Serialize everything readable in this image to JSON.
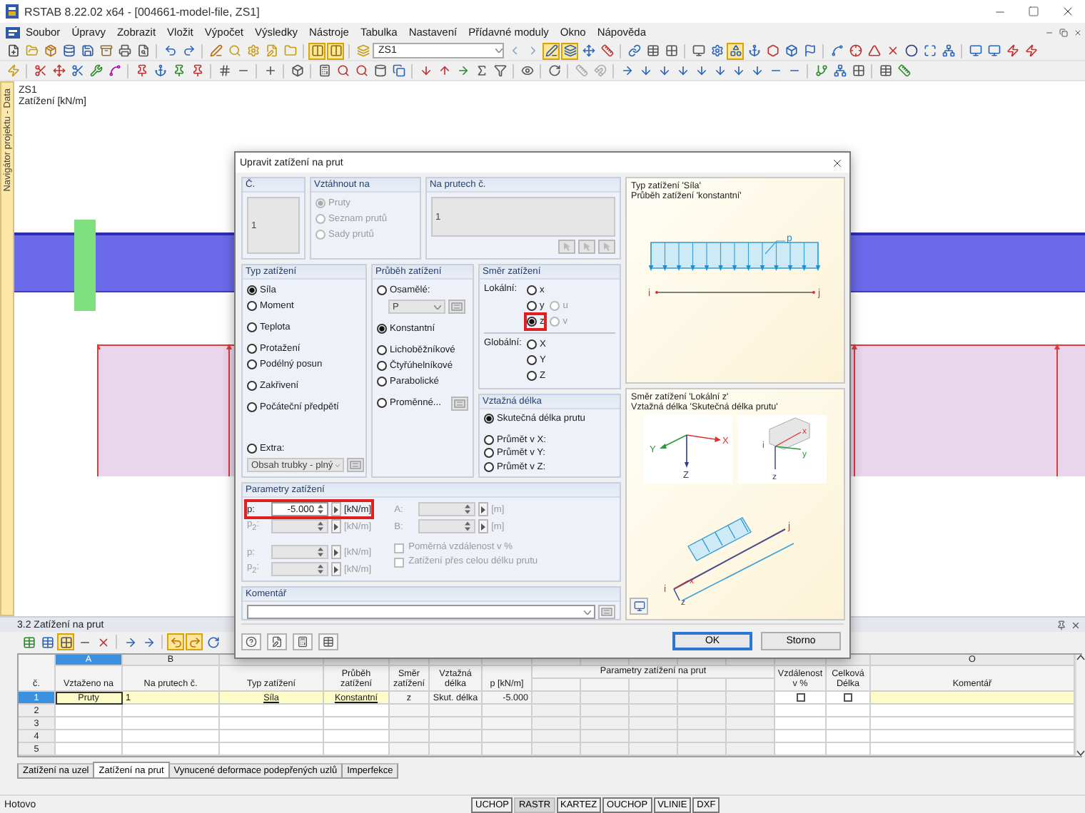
{
  "window": {
    "title": "RSTAB 8.22.02 x64 - [004661-model-file, ZS1]"
  },
  "menu": [
    "Soubor",
    "Úpravy",
    "Zobrazit",
    "Vložit",
    "Výpočet",
    "Výsledky",
    "Nástroje",
    "Tabulka",
    "Nastavení",
    "Přídavné moduly",
    "Okno",
    "Nápověda"
  ],
  "toolbar": {
    "load_case": "ZS1"
  },
  "navigator_tab": "Navigátor projektu - Data",
  "workspace": {
    "title": "ZS1",
    "subtitle": "Zatížení [kN/m]"
  },
  "dialog": {
    "title": "Upravit zatížení na prut",
    "number": {
      "label": "Č.",
      "value": "1"
    },
    "relate_to": {
      "label": "Vztáhnout na",
      "options": [
        {
          "label": "Pruty",
          "selected": true,
          "disabled": true
        },
        {
          "label": "Seznam prutů",
          "selected": false,
          "disabled": true
        },
        {
          "label": "Sady prutů",
          "selected": false,
          "disabled": true
        }
      ]
    },
    "members": {
      "label": "Na prutech č.",
      "value": "1"
    },
    "load_type": {
      "label": "Typ zatížení",
      "groups": [
        [
          {
            "label": "Síla",
            "selected": true
          },
          {
            "label": "Moment",
            "selected": false
          }
        ],
        [
          {
            "label": "Teplota",
            "selected": false
          }
        ],
        [
          {
            "label": "Protažení",
            "selected": false
          },
          {
            "label": "Podélný posun",
            "selected": false
          }
        ],
        [
          {
            "label": "Zakřivení",
            "selected": false
          }
        ],
        [
          {
            "label": "Počáteční předpětí",
            "selected": false
          }
        ]
      ],
      "extra": {
        "label": "Extra:",
        "selected": false,
        "value": "Obsah trubky - plný"
      }
    },
    "distribution": {
      "label": "Průběh zatížení",
      "concentrated": {
        "label": "Osamělé:",
        "selected": false,
        "value": "P"
      },
      "groups": [
        [
          {
            "label": "Konstantní",
            "selected": true
          }
        ],
        [
          {
            "label": "Lichoběžníkové",
            "selected": false
          },
          {
            "label": "Čtyřúhelníkové",
            "selected": false
          },
          {
            "label": "Parabolické",
            "selected": false
          }
        ]
      ],
      "varying": {
        "label": "Proměnné...",
        "selected": false
      }
    },
    "direction": {
      "label": "Směr zatížení",
      "local_label": "Lokální:",
      "local": [
        {
          "label": "x",
          "selected": false,
          "highlighted": false
        },
        {
          "label": "y",
          "selected": false,
          "highlighted": false
        },
        {
          "label": "z",
          "selected": true,
          "highlighted": true
        }
      ],
      "local_extra": [
        {
          "label": "u",
          "selected": false,
          "disabled": true
        },
        {
          "label": "v",
          "selected": false,
          "disabled": true
        }
      ],
      "global_label": "Globální:",
      "global": [
        {
          "label": "X",
          "selected": false
        },
        {
          "label": "Y",
          "selected": false
        },
        {
          "label": "Z",
          "selected": false
        }
      ]
    },
    "reference_length": {
      "label": "Vztažná délka",
      "options": [
        {
          "label": "Skutečná délka prutu",
          "selected": true
        },
        {
          "label": "Průmět v X:",
          "selected": false
        },
        {
          "label": "Průmět v Y:",
          "selected": false
        },
        {
          "label": "Průmět v Z:",
          "selected": false
        }
      ]
    },
    "parameters": {
      "label": "Parametry zatížení",
      "fields": [
        {
          "label": "p:",
          "value": "-5.000",
          "unit": "[kN/m]",
          "disabled": false,
          "highlighted": true
        },
        {
          "label": "p$_{2}$:",
          "unit": "[kN/m]",
          "disabled": true,
          "highlighted": false
        },
        {
          "label": "p:",
          "unit": "[kN/m]",
          "disabled": true,
          "highlighted": false
        },
        {
          "label": "p$_{2}$:",
          "unit": "[kN/m]",
          "disabled": true,
          "highlighted": false
        }
      ],
      "right_fields": [
        {
          "label": "A:",
          "unit": "[m]",
          "disabled": true
        },
        {
          "label": "B:",
          "unit": "[m]",
          "disabled": true
        }
      ],
      "checks": [
        {
          "label": "Poměrná vzdálenost v %",
          "checked": false,
          "disabled": true
        },
        {
          "label": "Zatížení přes celou délku prutu",
          "checked": false,
          "disabled": true
        }
      ]
    },
    "comment": {
      "label": "Komentář"
    },
    "preview_type": {
      "lines": [
        "Typ zatížení 'Síla'",
        "Průběh zatížení 'konstantní'"
      ],
      "labels": [
        "p",
        "i",
        "j"
      ]
    },
    "preview_direction": {
      "lines": [
        "Směr zatížení 'Lokální z'",
        "Vztažná délka 'Skutečná délka prutu'"
      ],
      "global_axes": [
        "X",
        "Y",
        "Z"
      ],
      "local_axes": [
        "x",
        "i",
        "y",
        "z"
      ],
      "member_labels": [
        "j",
        "i",
        "x",
        "z"
      ]
    },
    "buttons": [
      "OK",
      "Storno"
    ]
  },
  "panel": {
    "title": "3.2 Zatížení na prut"
  },
  "table": {
    "row_header": "č.",
    "group_header": "Parametry zatížení na prut",
    "columns": [
      {
        "letter": "A",
        "header": "Vztaženo na",
        "kind": "text",
        "selected": true
      },
      {
        "letter": "B",
        "header": "Na prutech č.",
        "kind": "text",
        "selected": false
      },
      {
        "header": "Typ zatížení",
        "kind": "list",
        "selected": false
      },
      {
        "header": "Průběh\nzatížení",
        "kind": "list",
        "selected": false
      },
      {
        "header": "Směr\nzatížení",
        "kind": "text",
        "selected": false
      },
      {
        "header": "Vztažná\ndélka",
        "kind": "text",
        "selected": false
      },
      {
        "header": "p [kN/m]",
        "kind": "number",
        "selected": false
      },
      {
        "kind": "param",
        "selected": false
      },
      {
        "kind": "param",
        "selected": false
      },
      {
        "kind": "param",
        "selected": false
      },
      {
        "kind": "param",
        "selected": false
      },
      {
        "kind": "param",
        "selected": false
      },
      {
        "header": "Vzdálenost\nv %",
        "kind": "check",
        "selected": false
      },
      {
        "header": "Celková\nDélka",
        "kind": "check",
        "selected": false
      },
      {
        "letter": "O",
        "header": "Komentář",
        "kind": "comment",
        "selected": false
      }
    ],
    "rows": [
      {
        "number": "1",
        "selected": true,
        "values": [
          "Pruty",
          "1",
          "Síla",
          "Konstantní",
          "z",
          "Skut. délka",
          "-5.000"
        ],
        "checks": [
          false,
          false
        ]
      },
      {
        "number": "2",
        "selected": false
      },
      {
        "number": "3",
        "selected": false
      },
      {
        "number": "4",
        "selected": false
      },
      {
        "number": "5",
        "selected": false
      }
    ]
  },
  "tabs": [
    {
      "label": "Zatížení na uzel",
      "selected": false
    },
    {
      "label": "Zatížení na prut",
      "selected": true
    },
    {
      "label": "Vynucené deformace podepřených uzlů",
      "selected": false
    },
    {
      "label": "Imperfekce",
      "selected": false
    }
  ],
  "status_bar": {
    "text": "Hotovo",
    "toggles": [
      {
        "label": "UCHOP",
        "on": false
      },
      {
        "label": "RASTR",
        "on": true
      },
      {
        "label": "KARTEZ",
        "on": false
      },
      {
        "label": "OUCHOP",
        "on": false
      },
      {
        "label": "VLINIE",
        "on": false
      },
      {
        "label": "DXF",
        "on": false
      }
    ]
  }
}
